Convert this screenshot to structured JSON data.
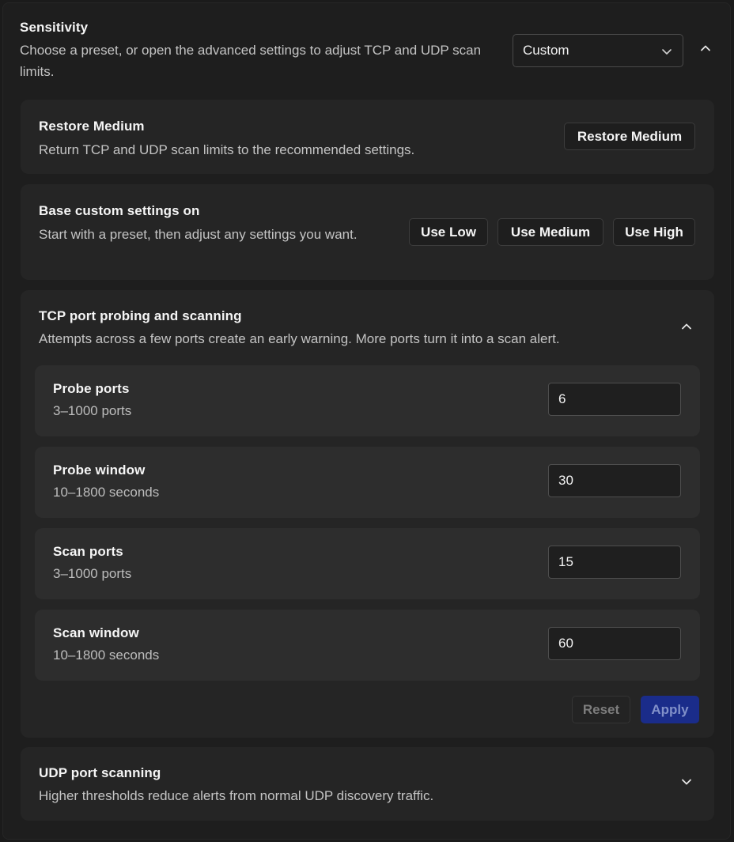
{
  "sensitivity": {
    "title": "Sensitivity",
    "description": "Choose a preset, or open the advanced settings to adjust TCP and UDP scan limits.",
    "preset_value": "Custom"
  },
  "restore": {
    "title": "Restore Medium",
    "description": "Return TCP and UDP scan limits to the recommended settings.",
    "button_label": "Restore Medium"
  },
  "base": {
    "title": "Base custom settings on",
    "description": "Start with a preset, then adjust any settings you want.",
    "buttons": [
      "Use Low",
      "Use Medium",
      "Use High"
    ]
  },
  "tcp": {
    "title": "TCP port probing and scanning",
    "description": "Attempts across a few ports create an early warning. More ports turn it into a scan alert.",
    "settings": [
      {
        "label": "Probe ports",
        "range": "3–1000 ports",
        "value": "6"
      },
      {
        "label": "Probe window",
        "range": "10–1800 seconds",
        "value": "30"
      },
      {
        "label": "Scan ports",
        "range": "3–1000 ports",
        "value": "15"
      },
      {
        "label": "Scan window",
        "range": "10–1800 seconds",
        "value": "60"
      }
    ],
    "reset_label": "Reset",
    "apply_label": "Apply"
  },
  "udp": {
    "title": "UDP port scanning",
    "description": "Higher thresholds reduce alerts from normal UDP discovery traffic."
  },
  "icons": {
    "select_chevron": "chevron-down-icon",
    "sensitivity_toggle": "chevron-up-icon",
    "tcp_toggle": "chevron-up-icon",
    "udp_toggle": "chevron-down-icon"
  },
  "colors": {
    "background": "#1e1e1e",
    "card": "#252525",
    "row": "#2d2d2d",
    "apply_button": "#1a2c8a"
  }
}
